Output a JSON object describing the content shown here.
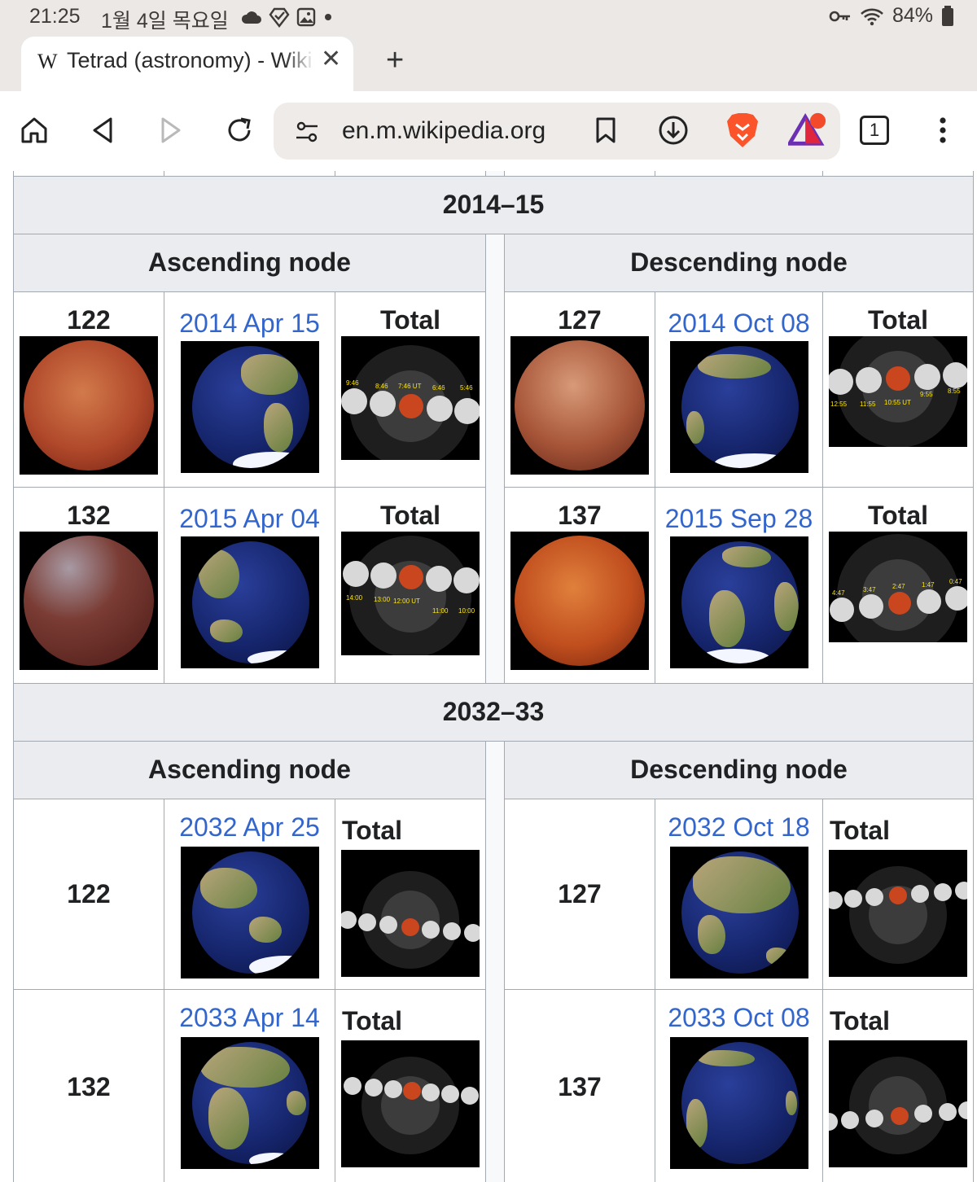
{
  "status": {
    "time": "21:25",
    "date": "1월 4일 목요일",
    "battery": "84%",
    "icons": [
      "cloud-icon",
      "vpn-icon",
      "gallery-icon",
      "dot-icon"
    ],
    "right_icons": [
      "key-icon",
      "wifi-icon",
      "battery-icon"
    ]
  },
  "tab": {
    "favicon": "W",
    "title": "Tetrad (astronomy) - Wikipedia",
    "close": "✕",
    "new_tab": "+"
  },
  "toolbar": {
    "url": "en.m.wikipedia.org",
    "tab_count": "1"
  },
  "tetrads": [
    {
      "years": "2014–15",
      "ascending_label": "Ascending node",
      "descending_label": "Descending node",
      "rows": [
        {
          "asc": {
            "saros": "122",
            "date": "2014 Apr 15",
            "type": "Total",
            "times": [
              "9:46",
              "8:46",
              "7:46 UT",
              "6:46",
              "5:46"
            ]
          },
          "desc": {
            "saros": "127",
            "date": "2014 Oct 08",
            "type": "Total",
            "times": [
              "12:55",
              "11:55",
              "10:55 UT",
              "9:55",
              "8:55"
            ]
          }
        },
        {
          "asc": {
            "saros": "132",
            "date": "2015 Apr 04",
            "type": "Total",
            "times": [
              "14:00",
              "13:00",
              "12:00 UT",
              "11:00",
              "10:00"
            ]
          },
          "desc": {
            "saros": "137",
            "date": "2015 Sep 28",
            "type": "Total",
            "times": [
              "4:47",
              "3:47",
              "2:47",
              "1:47",
              "0:47"
            ]
          }
        }
      ]
    },
    {
      "years": "2032–33",
      "ascending_label": "Ascending node",
      "descending_label": "Descending node",
      "rows": [
        {
          "asc": {
            "saros": "122",
            "date": "2032 Apr 25",
            "type": "Total"
          },
          "desc": {
            "saros": "127",
            "date": "2032 Oct 18",
            "type": "Total"
          }
        },
        {
          "asc": {
            "saros": "132",
            "date": "2033 Apr 14",
            "type": "Total"
          },
          "desc": {
            "saros": "137",
            "date": "2033 Oct 08",
            "type": "Total"
          }
        }
      ]
    }
  ],
  "colors": {
    "link": "#3366cc",
    "header_bg": "#eaecf0",
    "border": "#a2a9b1",
    "brave_orange": "#fb542b"
  }
}
